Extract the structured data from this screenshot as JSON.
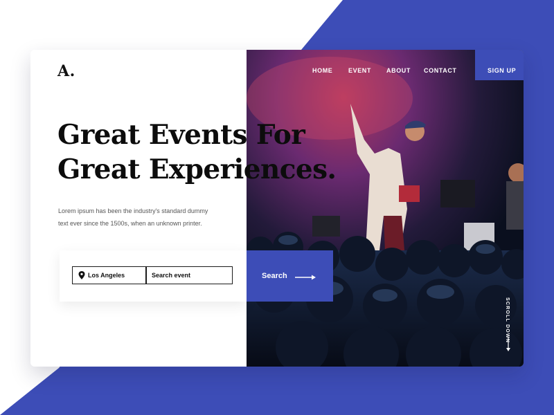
{
  "brand": {
    "logo": "A."
  },
  "nav": {
    "items": [
      {
        "label": "HOME"
      },
      {
        "label": "EVENT"
      },
      {
        "label": "ABOUT"
      },
      {
        "label": "CONTACT"
      }
    ],
    "signup": "SIGN UP"
  },
  "hero": {
    "headline_line1": "Great Events For",
    "headline_line2": "Great Experiences.",
    "lead_line1": "Lorem ipsum has been the industry's standard dummy",
    "lead_line2": "text ever since the 1500s, when an unknown printer."
  },
  "search": {
    "location_value": "Los Angeles",
    "event_placeholder": "Search event",
    "button_label": "Search"
  },
  "scroll": {
    "label": "SCROLL DOWN"
  },
  "icons": {
    "pin": "location-pin-icon",
    "arrow": "arrow-right-icon",
    "scroll_arrow": "arrow-down-icon"
  },
  "colors": {
    "accent": "#3d4db7",
    "text_dark": "#0c0c0c",
    "background": "#ffffff"
  }
}
